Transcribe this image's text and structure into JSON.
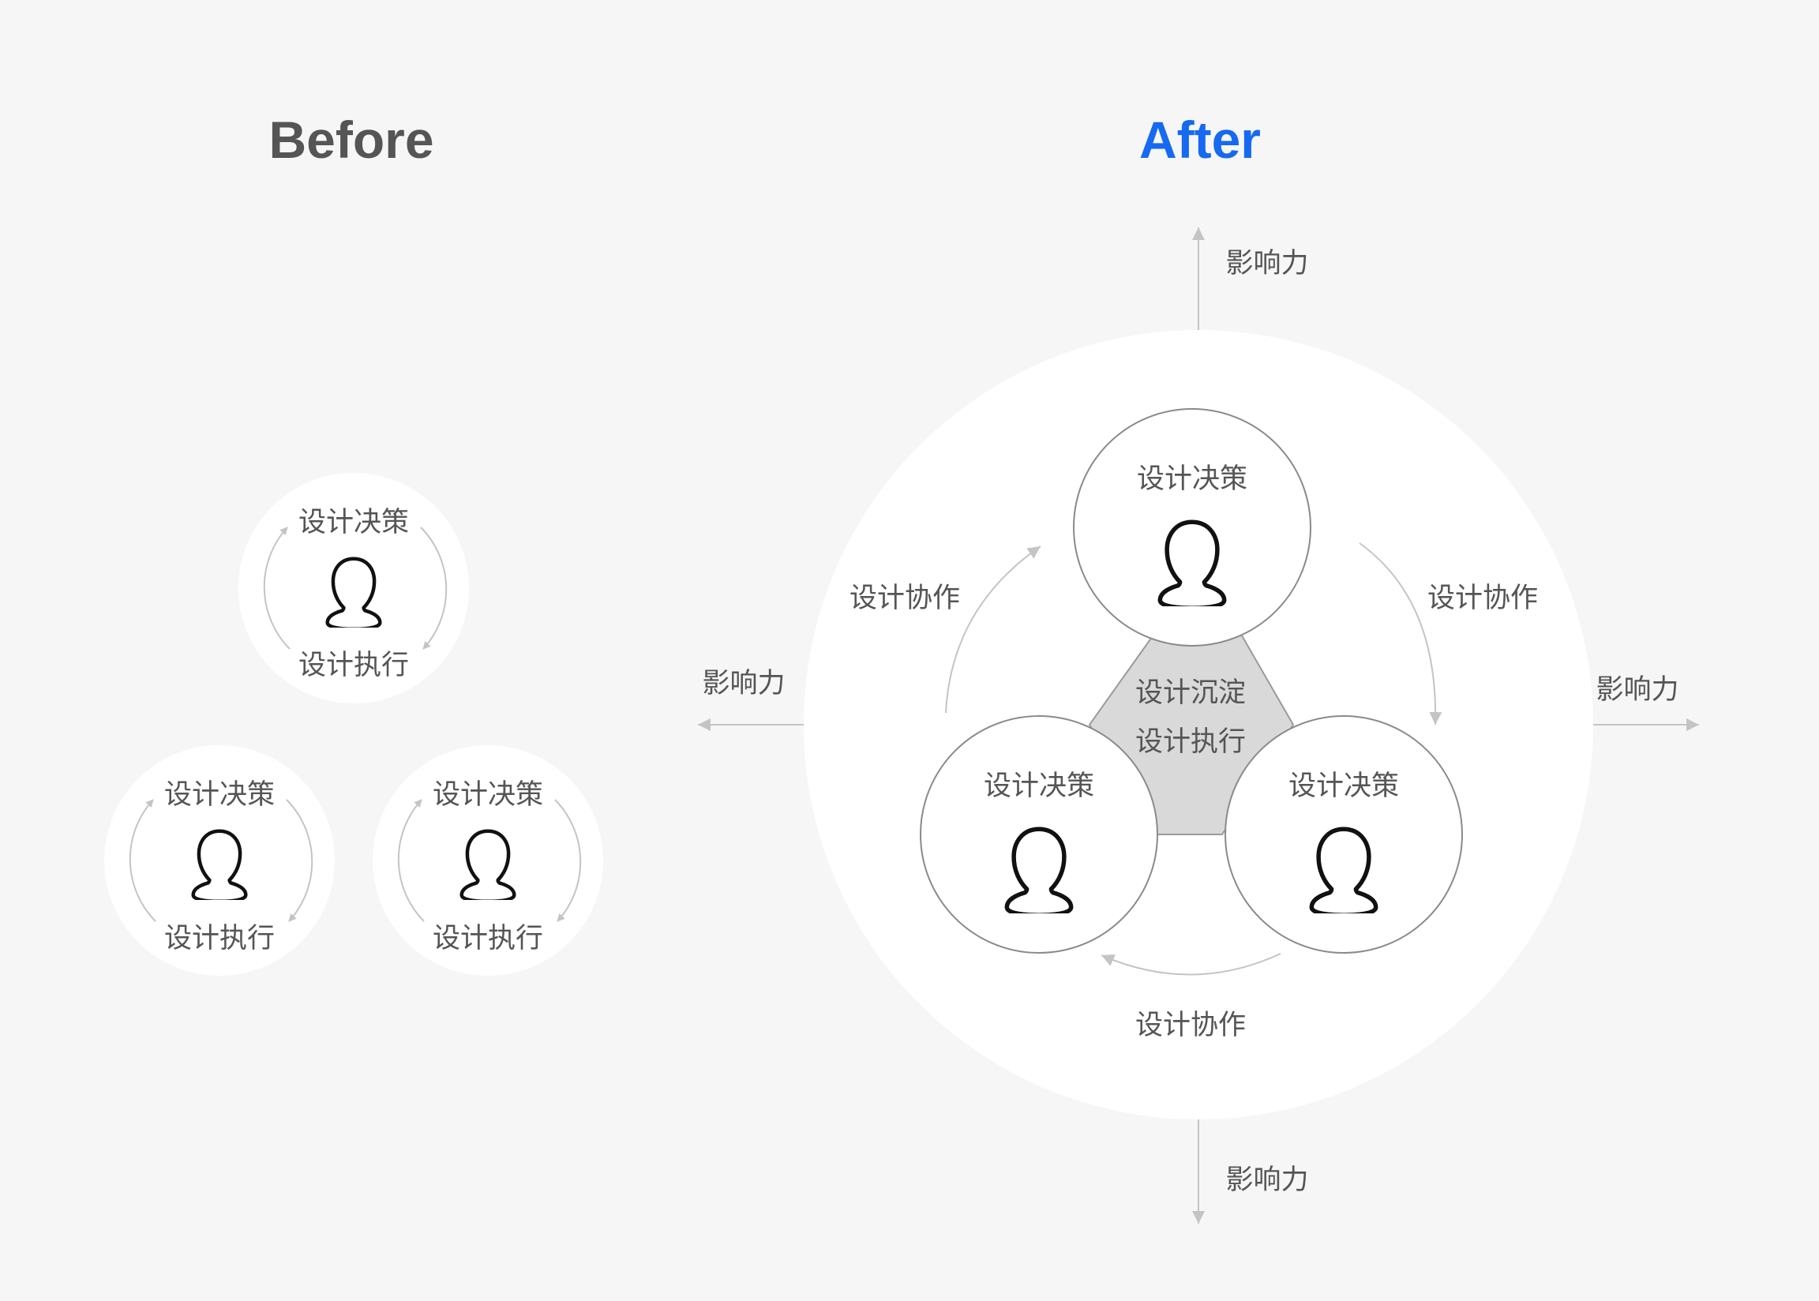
{
  "before": {
    "title": "Before",
    "units": [
      {
        "top_label": "设计决策",
        "bottom_label": "设计执行"
      },
      {
        "top_label": "设计决策",
        "bottom_label": "设计执行"
      },
      {
        "top_label": "设计决策",
        "bottom_label": "设计执行"
      }
    ]
  },
  "after": {
    "title": "After",
    "designers": [
      {
        "label": "设计决策"
      },
      {
        "label": "设计决策"
      },
      {
        "label": "设计决策"
      }
    ],
    "center": {
      "line1": "设计沉淀",
      "line2": "设计执行"
    },
    "collaboration": [
      "设计协作",
      "设计协作",
      "设计协作"
    ],
    "influence": [
      "影响力",
      "影响力",
      "影响力",
      "影响力"
    ]
  },
  "colors": {
    "before_title": "#555555",
    "after_title": "#1669f0",
    "text": "#555555",
    "arrow": "#c4c4c4",
    "circle_stroke": "#8a8a8a",
    "triangle_fill": "#d9d9d9",
    "icon": "#111111",
    "page_bg": "#f5f6f5",
    "panel_bg": "#ffffff"
  },
  "icons": [
    "person-icon",
    "arrow-icon"
  ]
}
